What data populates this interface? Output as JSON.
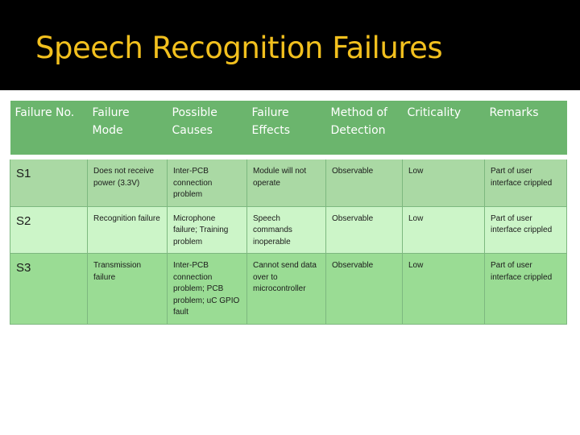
{
  "slide": {
    "title": "Speech Recognition Failures"
  },
  "table": {
    "headers": [
      "Failure No.",
      "Failure Mode",
      "Possible Causes",
      "Failure Effects",
      "Method of Detection",
      "Criticality",
      "Remarks"
    ],
    "rows": [
      {
        "failure_no": "S1",
        "failure_mode": "Does not receive power (3.3V)",
        "possible_causes": "Inter-PCB connection problem",
        "failure_effects": "Module will not operate",
        "method_of_detection": "Observable",
        "criticality": "Low",
        "remarks": "Part of user interface crippled"
      },
      {
        "failure_no": "S2",
        "failure_mode": "Recognition failure",
        "possible_causes": "Microphone failure; Training problem",
        "failure_effects": "Speech commands inoperable",
        "method_of_detection": "Observable",
        "criticality": "Low",
        "remarks": "Part of user interface crippled"
      },
      {
        "failure_no": "S3",
        "failure_mode": "Transmission failure",
        "possible_causes": "Inter-PCB connection problem; PCB problem; uC GPIO fault",
        "failure_effects": "Cannot send data over to microcontroller",
        "method_of_detection": "Observable",
        "criticality": "Low",
        "remarks": "Part of user interface crippled"
      }
    ]
  },
  "colors": {
    "title_bar": "#000000",
    "title_text": "#f2c01e",
    "header_bg": "#6bb56d",
    "row_1_bg": "#aad9a4",
    "row_2_bg": "#ccf5c8",
    "row_3_bg": "#9adc94"
  }
}
